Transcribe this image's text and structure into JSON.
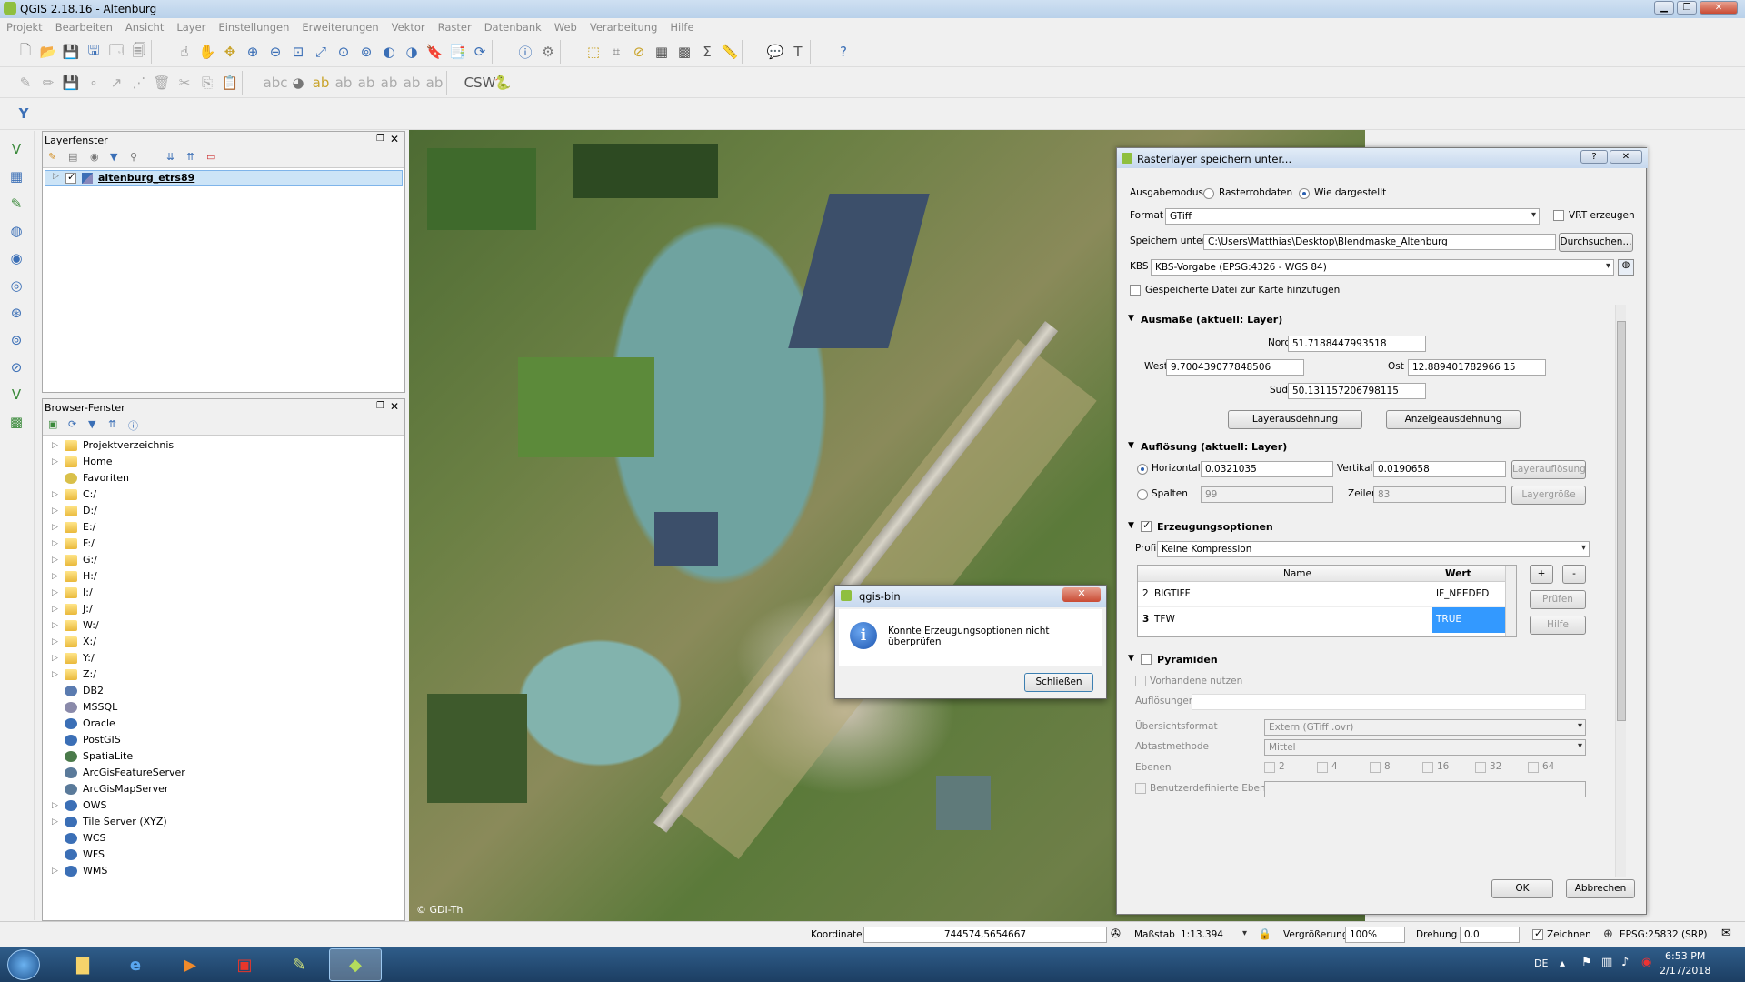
{
  "window": {
    "title": "QGIS 2.18.16 - Altenburg"
  },
  "menu": [
    "Projekt",
    "Bearbeiten",
    "Ansicht",
    "Layer",
    "Einstellungen",
    "Erweiterungen",
    "Vektor",
    "Raster",
    "Datenbank",
    "Web",
    "Verarbeitung",
    "Hilfe"
  ],
  "layers_panel": {
    "title": "Layerfenster",
    "layer": "altenburg_etrs89"
  },
  "browser_panel": {
    "title": "Browser-Fenster",
    "items": [
      "Projektverzeichnis",
      "Home",
      "Favoriten",
      "C:/",
      "D:/",
      "E:/",
      "F:/",
      "G:/",
      "H:/",
      "I:/",
      "J:/",
      "W:/",
      "X:/",
      "Y:/",
      "Z:/",
      "DB2",
      "MSSQL",
      "Oracle",
      "PostGIS",
      "SpatiaLite",
      "ArcGisFeatureServer",
      "ArcGisMapServer",
      "OWS",
      "Tile Server (XYZ)",
      "WCS",
      "WFS",
      "WMS"
    ]
  },
  "map": {
    "copyright": "© GDI-Th"
  },
  "raster_dialog": {
    "title": "Rasterlayer speichern unter...",
    "mode_label": "Ausgabemodus",
    "mode_raw": "Rasterrohdaten",
    "mode_rendered": "Wie dargestellt",
    "format_label": "Format",
    "format": "GTiff",
    "vrt": "VRT erzeugen",
    "save_label": "Speichern unter",
    "save_path": "C:\\Users\\Matthias\\Desktop\\Blendmaske_Altenburg",
    "browse": "Durchsuchen...",
    "crs_label": "KBS",
    "crs": "KBS-Vorgabe (EPSG:4326 - WGS 84)",
    "add_to_map": "Gespeicherte Datei zur Karte hinzufügen",
    "extent_title": "Ausmaße (aktuell: Layer)",
    "north_label": "Nord",
    "north": "51.7188447993518",
    "west_label": "West",
    "west": "9.700439077848506",
    "east_label": "Ost",
    "east": "12.889401782966 15",
    "south_label": "Süd",
    "south": "50.131157206798115",
    "layer_extent": "Layerausdehnung",
    "map_extent": "Anzeigeausdehnung",
    "res_title": "Auflösung (aktuell: Layer)",
    "horiz_label": "Horizontal",
    "horiz": "0.0321035",
    "vert_label": "Vertikal",
    "vert": "0.0190658",
    "layer_res": "Layerauflösung",
    "cols_label": "Spalten",
    "cols": "99",
    "rows_label": "Zeilen",
    "rows": "83",
    "layer_size": "Layergröße",
    "create_title": "Erzeugungsoptionen",
    "profile_label": "Profil",
    "profile": "Keine Kompression",
    "table": {
      "headers": [
        "Name",
        "Wert"
      ],
      "rows": [
        [
          "2",
          "BIGTIFF",
          "IF_NEEDED"
        ],
        [
          "3",
          "TFW",
          "TRUE"
        ]
      ]
    },
    "plus": "+",
    "minus": "-",
    "check": "Prüfen",
    "help": "Hilfe",
    "pyr_title": "Pyramiden",
    "existing": "Vorhandene nutzen",
    "resolutions": "Auflösungen",
    "overview_label": "Übersichtsformat",
    "overview": "Extern (GTiff .ovr)",
    "resample_label": "Abtastmethode",
    "resample": "Mittel",
    "levels_label": "Ebenen",
    "levels": [
      "2",
      "4",
      "8",
      "16",
      "32",
      "64"
    ],
    "custom_levels": "Benutzerdefinierte Ebenen",
    "ok": "OK",
    "cancel": "Abbrechen",
    "q": "?",
    "x": "✕"
  },
  "msgbox": {
    "title": "qgis-bin",
    "text": "Konnte Erzeugungsoptionen nicht überprüfen",
    "button": "Schließen"
  },
  "status": {
    "coord_label": "Koordinate",
    "coord": "744574,5654667",
    "scale_label": "Maßstab",
    "scale": "1:13.394",
    "mag_label": "Vergrößerung",
    "mag": "100%",
    "rot_label": "Drehung",
    "rot": "0.0",
    "render": "Zeichnen",
    "crs": "EPSG:25832 (SRP)"
  },
  "taskbar": {
    "lang": "DE",
    "time": "6:53 PM",
    "date": "2/17/2018"
  }
}
